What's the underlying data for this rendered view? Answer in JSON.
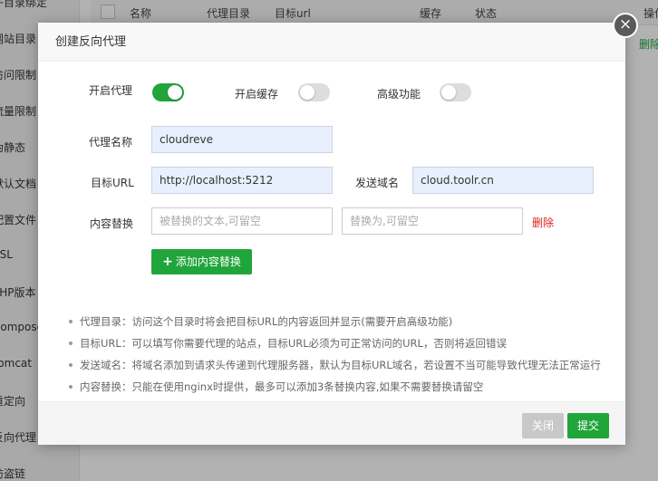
{
  "background": {
    "sidebar_items": [
      "子目录绑定",
      "网站目录",
      "访问限制",
      "流量限制",
      "伪静态",
      "默认文档",
      "配置文件",
      "SSL",
      "PHP版本",
      "Composer",
      "Tomcat",
      "重定向",
      "反向代理",
      "防盗链"
    ],
    "table_columns": [
      "名称",
      "代理目录",
      "目标url",
      "缓存",
      "状态",
      "操作"
    ],
    "row_action": "删除"
  },
  "modal": {
    "title": "创建反向代理",
    "close_icon": "×",
    "toggles": {
      "enable_proxy": {
        "label": "开启代理",
        "on": true
      },
      "enable_cache": {
        "label": "开启缓存",
        "on": false
      },
      "advanced": {
        "label": "高级功能",
        "on": false
      }
    },
    "proxy_name": {
      "label": "代理名称",
      "value": "cloudreve"
    },
    "target_url": {
      "label": "目标URL",
      "value": "http://localhost:5212"
    },
    "send_domain": {
      "label": "发送域名",
      "value": "cloud.toolr.cn"
    },
    "content_replace": {
      "label": "内容替换",
      "from_placeholder": "被替换的文本,可留空",
      "to_placeholder": "替换为,可留空",
      "delete_label": "删除"
    },
    "add_replace_button": "添加内容替换",
    "tips": [
      "代理目录：访问这个目录时将会把目标URL的内容返回并显示(需要开启高级功能)",
      "目标URL：可以填写你需要代理的站点，目标URL必须为可正常访问的URL，否则将返回错误",
      "发送域名：将域名添加到请求头传递到代理服务器，默认为目标URL域名，若设置不当可能导致代理无法正常运行",
      "内容替换：只能在使用nginx时提供，最多可以添加3条替换内容,如果不需要替换请留空"
    ],
    "footer": {
      "close_label": "关闭",
      "submit_label": "提交"
    }
  },
  "colors": {
    "accent": "#20a53a",
    "danger": "#e02020"
  }
}
